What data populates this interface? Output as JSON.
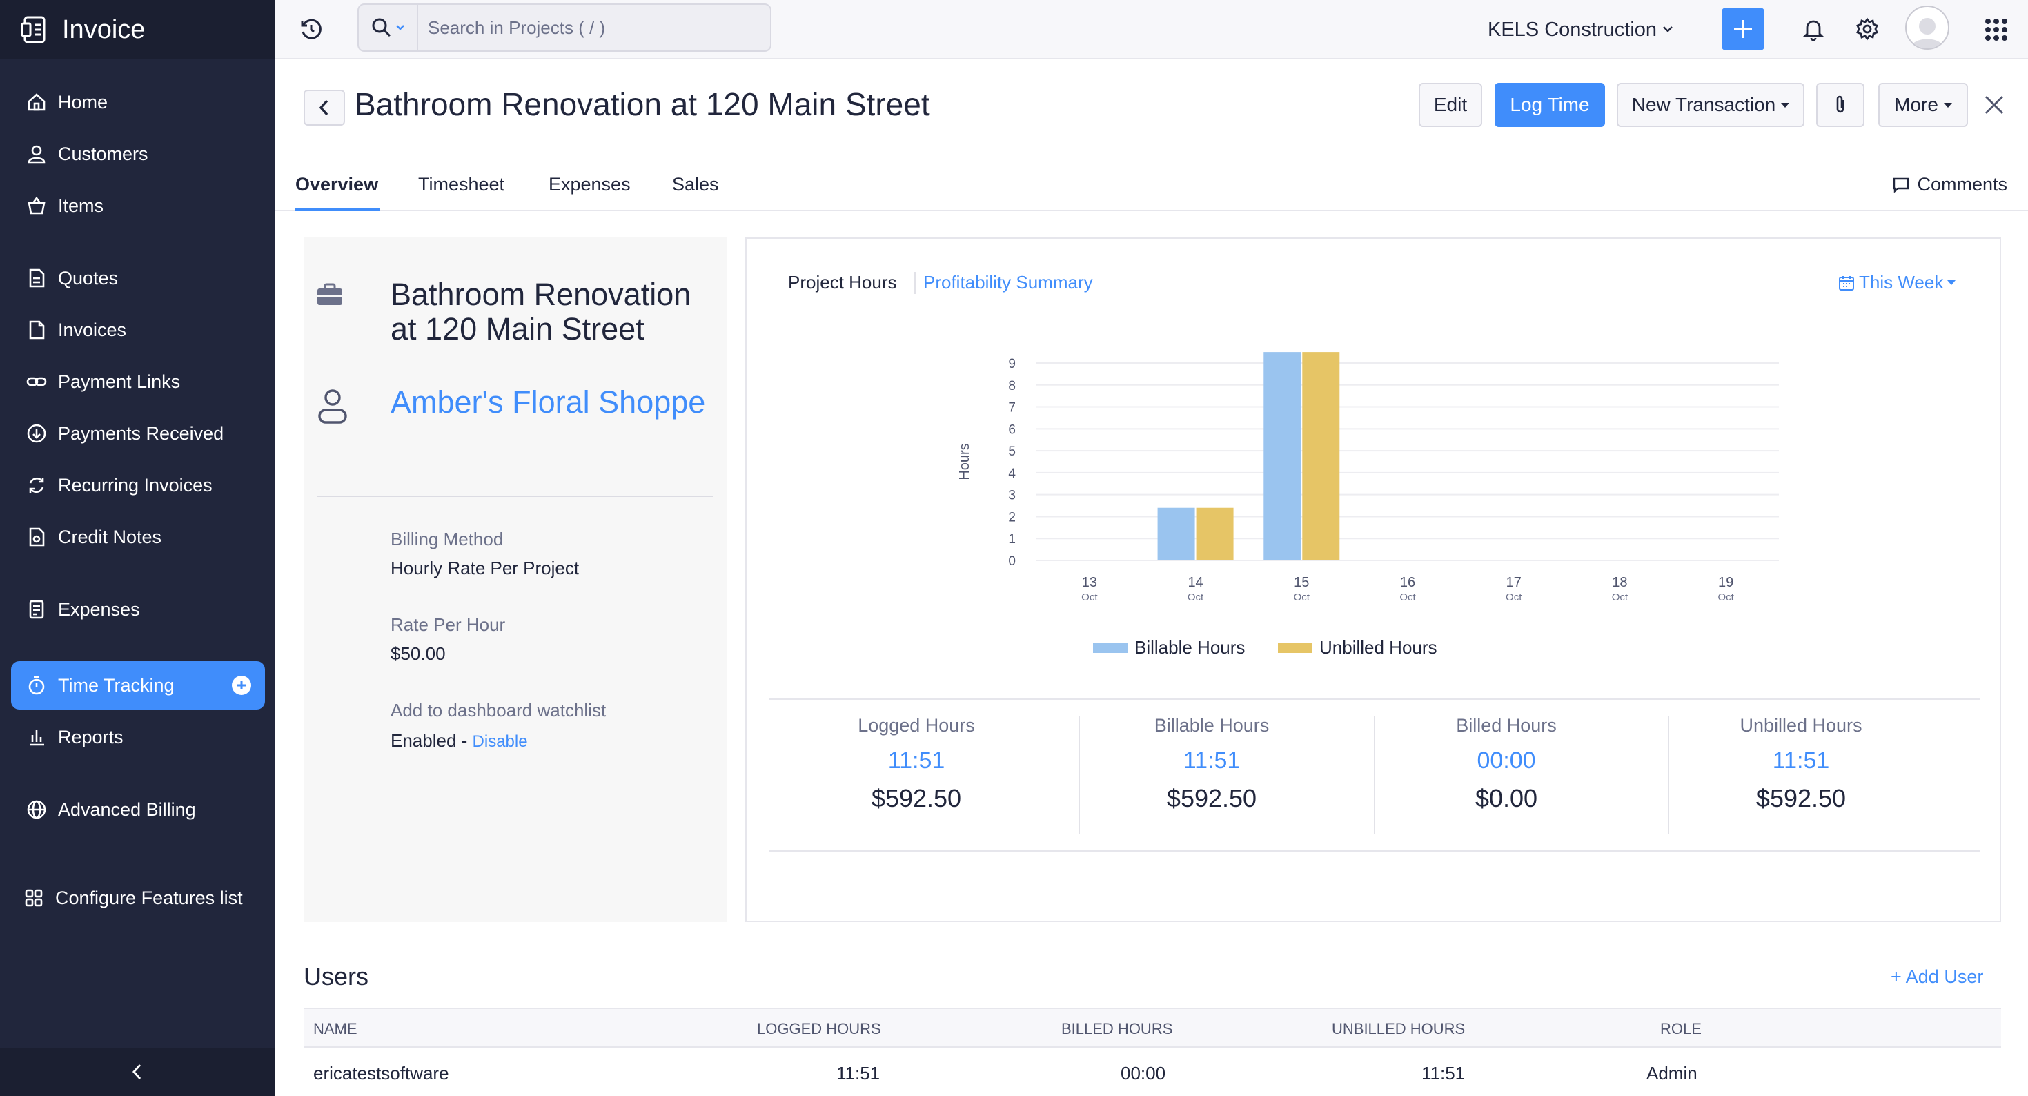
{
  "app": {
    "name": "Invoice"
  },
  "sidebar": {
    "items": [
      {
        "label": "Home",
        "icon": "home-icon"
      },
      {
        "label": "Customers",
        "icon": "user-icon"
      },
      {
        "label": "Items",
        "icon": "basket-icon"
      },
      {
        "label": "Quotes",
        "icon": "quote-doc-icon"
      },
      {
        "label": "Invoices",
        "icon": "invoice-doc-icon"
      },
      {
        "label": "Payment Links",
        "icon": "link-icon"
      },
      {
        "label": "Payments Received",
        "icon": "payment-icon"
      },
      {
        "label": "Recurring Invoices",
        "icon": "recurring-icon"
      },
      {
        "label": "Credit Notes",
        "icon": "credit-note-icon"
      },
      {
        "label": "Expenses",
        "icon": "receipt-icon"
      },
      {
        "label": "Time Tracking",
        "icon": "stopwatch-icon",
        "active": true
      },
      {
        "label": "Reports",
        "icon": "bar-chart-icon"
      },
      {
        "label": "Advanced Billing",
        "icon": "globe-icon"
      },
      {
        "label": "Configure Features list",
        "icon": "grid-config-icon"
      }
    ]
  },
  "topbar": {
    "search_placeholder": "Search in Projects ( / )",
    "org_name": "KELS Construction"
  },
  "header": {
    "title": "Bathroom Renovation at 120 Main Street",
    "edit_label": "Edit",
    "log_time_label": "Log Time",
    "new_transaction_label": "New Transaction",
    "more_label": "More"
  },
  "tabs": {
    "overview": "Overview",
    "timesheet": "Timesheet",
    "expenses": "Expenses",
    "sales": "Sales",
    "comments": "Comments"
  },
  "project": {
    "name": "Bathroom Renovation at 120 Main Street",
    "customer": "Amber's Floral Shoppe",
    "billing_method_label": "Billing Method",
    "billing_method": "Hourly Rate Per Project",
    "rate_label": "Rate Per Hour",
    "rate": "$50.00",
    "watchlist_label": "Add to dashboard watchlist",
    "watchlist_status": "Enabled - ",
    "watchlist_action": "Disable"
  },
  "card": {
    "tab_hours": "Project Hours",
    "tab_profit": "Profitability Summary",
    "period": "This Week"
  },
  "colors": {
    "accent": "#408dfb",
    "billable": "#9ac4ef",
    "unbilled": "#e6c566",
    "sidebar": "#21263c"
  },
  "chart_data": {
    "type": "bar",
    "ylabel": "Hours",
    "ylim": [
      0,
      9
    ],
    "yticks": [
      0,
      1,
      2,
      3,
      4,
      5,
      6,
      7,
      8,
      9
    ],
    "categories": [
      {
        "day": "13",
        "month": "Oct"
      },
      {
        "day": "14",
        "month": "Oct"
      },
      {
        "day": "15",
        "month": "Oct"
      },
      {
        "day": "16",
        "month": "Oct"
      },
      {
        "day": "17",
        "month": "Oct"
      },
      {
        "day": "18",
        "month": "Oct"
      },
      {
        "day": "19",
        "month": "Oct"
      }
    ],
    "series": [
      {
        "name": "Billable Hours",
        "color": "#9ac4ef",
        "values": [
          0,
          2.4,
          9.5,
          0,
          0,
          0,
          0
        ]
      },
      {
        "name": "Unbilled Hours",
        "color": "#e6c566",
        "values": [
          0,
          2.4,
          9.5,
          0,
          0,
          0,
          0
        ]
      }
    ]
  },
  "stats": [
    {
      "label": "Logged Hours",
      "time": "11:51",
      "amount": "$592.50"
    },
    {
      "label": "Billable Hours",
      "time": "11:51",
      "amount": "$592.50"
    },
    {
      "label": "Billed Hours",
      "time": "00:00",
      "amount": "$0.00"
    },
    {
      "label": "Unbilled Hours",
      "time": "11:51",
      "amount": "$592.50"
    }
  ],
  "users": {
    "title": "Users",
    "add_label": "+ Add User",
    "columns": [
      "NAME",
      "LOGGED HOURS",
      "BILLED HOURS",
      "UNBILLED HOURS",
      "ROLE"
    ],
    "rows": [
      {
        "name": "ericatestsoftware",
        "logged": "11:51",
        "billed": "00:00",
        "unbilled": "11:51",
        "role": "Admin"
      }
    ]
  }
}
